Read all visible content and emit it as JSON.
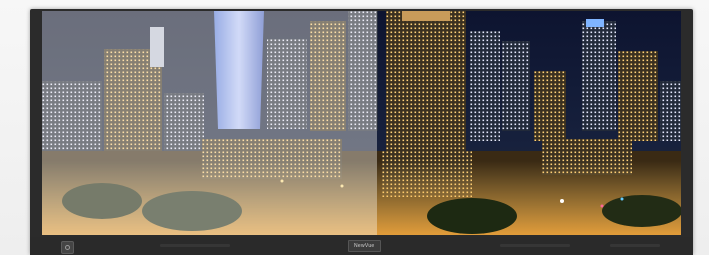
{
  "monitor": {
    "brand": "NewVue",
    "bezel_color": "#2b2b2b"
  },
  "screen": {
    "image_subject": "night-city-skyline-split-comparison",
    "left_half_tone": "washed-out",
    "right_half_tone": "vivid"
  },
  "icons": {
    "power": "power-button-icon"
  }
}
